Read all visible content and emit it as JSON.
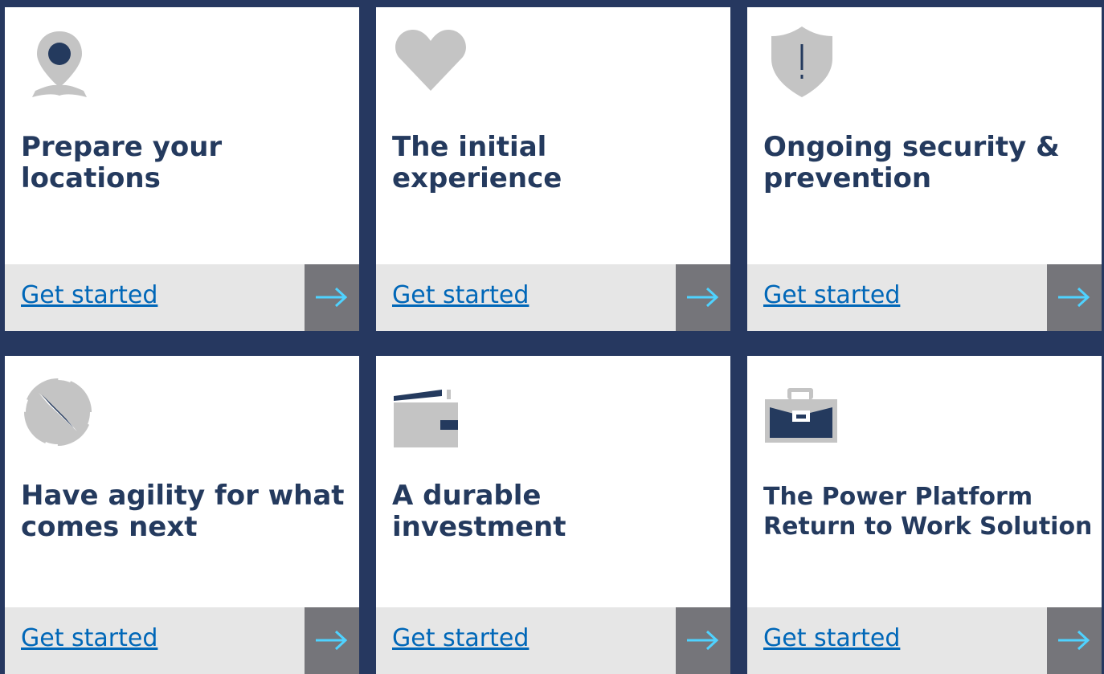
{
  "colors": {
    "background": "#263860",
    "card": "#ffffff",
    "title": "#243a5e",
    "link": "#0067b8",
    "cta_bar": "#e6e6e6",
    "arrow_box": "#75757a",
    "arrow": "#4fd2ff",
    "icon_gray": "#c4c4c4",
    "icon_navy": "#243a5e"
  },
  "cards": [
    {
      "title": "Prepare your locations",
      "link_label": "Get started",
      "icon": "location-pin-icon"
    },
    {
      "title": "The initial experience",
      "link_label": "Get started",
      "icon": "heart-icon"
    },
    {
      "title": "Ongoing security & prevention",
      "link_label": "Get started",
      "icon": "shield-alert-icon"
    },
    {
      "title": "Have agility for what comes next",
      "link_label": "Get started",
      "icon": "compass-icon"
    },
    {
      "title": "A durable investment",
      "link_label": "Get started",
      "icon": "wallet-icon"
    },
    {
      "title": "The Power Platform Return to Work Solution",
      "link_label": "Get started",
      "icon": "briefcase-icon"
    }
  ]
}
